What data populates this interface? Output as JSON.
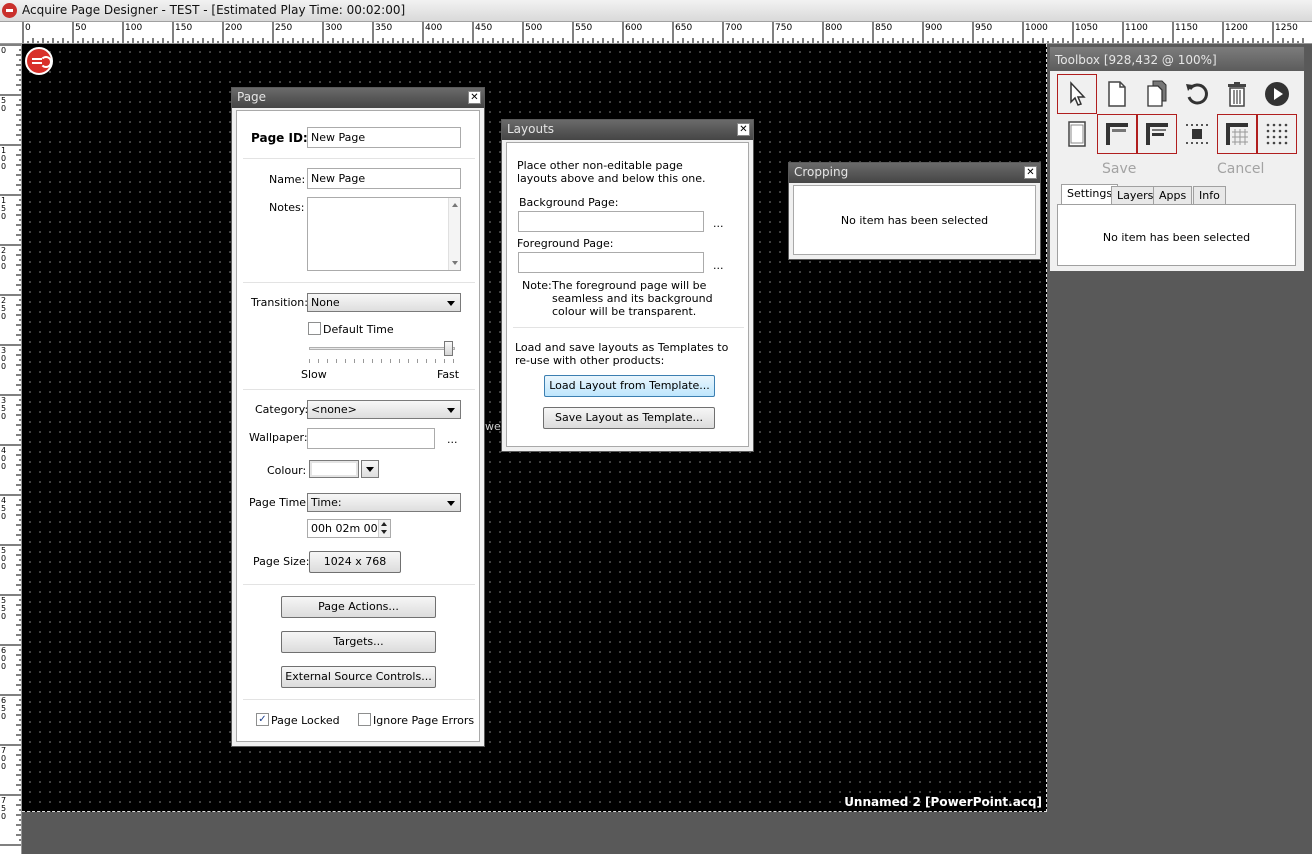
{
  "window": {
    "title": "Acquire Page Designer - TEST - [Estimated Play Time: 00:02:00]"
  },
  "ruler": {
    "h_labels": [
      "0",
      "50",
      "100",
      "150",
      "200",
      "250",
      "300",
      "350",
      "400",
      "450",
      "500",
      "550",
      "600",
      "650",
      "700",
      "750",
      "800",
      "850",
      "900",
      "950",
      "1000",
      "1050",
      "1100",
      "1150",
      "1200",
      "1250"
    ],
    "v_labels": [
      "0",
      "50",
      "100",
      "150",
      "200",
      "250",
      "300",
      "350",
      "400",
      "450",
      "500",
      "550",
      "600",
      "650",
      "700",
      "750"
    ]
  },
  "canvas": {
    "footer_name": "Unnamed 2 [PowerPoint.acq]",
    "partial_text": "we"
  },
  "page_panel": {
    "title": "Page",
    "page_id_label": "Page ID:",
    "page_id_value": "New Page",
    "name_label": "Name:",
    "name_value": "New Page",
    "notes_label": "Notes:",
    "transition_label": "Transition:",
    "transition_value": "None",
    "default_time_label": "Default Time",
    "default_time_checked": false,
    "slow_label": "Slow",
    "fast_label": "Fast",
    "category_label": "Category:",
    "category_value": "<none>",
    "wallpaper_label": "Wallpaper:",
    "wallpaper_browse": "...",
    "colour_label": "Colour:",
    "page_time_label": "Page Time:",
    "page_time_value": "Time:",
    "page_time_duration": "00h 02m 00s",
    "page_size_label": "Page Size:",
    "page_size_value": "1024 x 768",
    "page_actions_button": "Page Actions...",
    "targets_button": "Targets...",
    "external_source_button": "External Source Controls...",
    "page_locked_label": "Page Locked",
    "page_locked_checked": true,
    "ignore_errors_label": "Ignore Page Errors",
    "ignore_errors_checked": false
  },
  "layouts_panel": {
    "title": "Layouts",
    "intro": "Place other non-editable page layouts above and below this one.",
    "background_label": "Background Page:",
    "foreground_label": "Foreground Page:",
    "browse": "...",
    "note_prefix": "Note:",
    "note_text": "The foreground page will be seamless and its background colour will be transparent.",
    "template_text": "Load and save layouts as Templates to re-use with other products:",
    "load_button": "Load Layout from Template...",
    "save_button": "Save Layout as Template..."
  },
  "cropping_panel": {
    "title": "Cropping",
    "message": "No item has been selected"
  },
  "toolbox": {
    "title": "Toolbox [928,432 @ 100%]",
    "save_label": "Save",
    "cancel_label": "Cancel",
    "tabs": [
      "Settings",
      "Layers",
      "Apps",
      "Info"
    ],
    "message": "No item has been selected",
    "icons": [
      "pointer-icon",
      "new-page-icon",
      "copy-page-icon",
      "undo-icon",
      "delete-icon",
      "play-icon",
      "page-frame-icon",
      "top-left-align-icon",
      "left-align-icon",
      "center-square-icon",
      "grid-lines-icon",
      "dot-grid-icon"
    ]
  }
}
